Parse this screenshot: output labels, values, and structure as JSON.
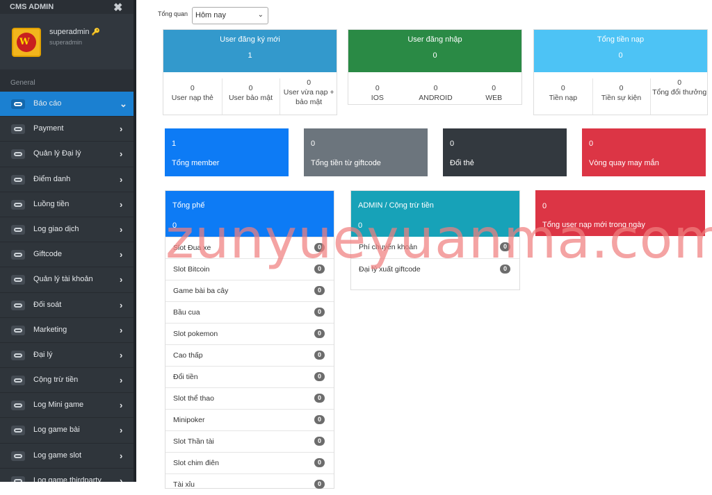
{
  "app_title": "CMS ADMIN",
  "profile": {
    "username": "superadmin",
    "role": "superadmin"
  },
  "section_label": "General",
  "menu": [
    {
      "label": "Báo cáo"
    },
    {
      "label": "Payment"
    },
    {
      "label": "Quản lý Đại lý"
    },
    {
      "label": "Điểm danh"
    },
    {
      "label": "Luồng tiền"
    },
    {
      "label": "Log giao dịch"
    },
    {
      "label": "Giftcode"
    },
    {
      "label": "Quản lý tài khoản"
    },
    {
      "label": "Đối soát"
    },
    {
      "label": "Marketing"
    },
    {
      "label": "Đại lý"
    },
    {
      "label": "Cộng trừ tiền"
    },
    {
      "label": "Log Mini game"
    },
    {
      "label": "Log game bài"
    },
    {
      "label": "Log game slot"
    },
    {
      "label": "Log game thirdparty"
    }
  ],
  "filter": {
    "label": "Tổng quan",
    "selected": "Hôm nay"
  },
  "cards": [
    {
      "title": "User đăng ký mới",
      "value": "1",
      "color": "#3399cc",
      "stats": [
        {
          "value": "0",
          "label": "User nạp thẻ"
        },
        {
          "value": "0",
          "label": "User bảo mật"
        },
        {
          "value": "0",
          "label": "User vừa nạp + bảo mật"
        }
      ]
    },
    {
      "title": "User đăng nhập",
      "value": "0",
      "color": "#2a8a45",
      "stats": [
        {
          "value": "0",
          "label": "IOS"
        },
        {
          "value": "0",
          "label": "ANDROID"
        },
        {
          "value": "0",
          "label": "WEB"
        }
      ]
    },
    {
      "title": "Tổng tiền nạp",
      "value": "0",
      "color": "#4dc3f5",
      "stats": [
        {
          "value": "0",
          "label": "Tiền nạp"
        },
        {
          "value": "0",
          "label": "Tiền sự kiện"
        },
        {
          "value": "0",
          "label": "Tổng đổi thưởng"
        }
      ]
    }
  ],
  "boxes": [
    {
      "value": "1",
      "label": "Tổng member",
      "color": "#0d7bf5"
    },
    {
      "value": "0",
      "label": "Tổng tiền từ giftcode",
      "color": "#6c757d"
    },
    {
      "value": "0",
      "label": "Đổi thẻ",
      "color": "#33393f"
    },
    {
      "value": "0",
      "label": "Vòng quay may mắn",
      "color": "#dc3545"
    }
  ],
  "panels": [
    {
      "title": "Tổng phế",
      "value": "0",
      "color": "#0d7bf5",
      "rows": [
        {
          "label": "Slot Đua xe",
          "badge": "0"
        },
        {
          "label": "Slot Bitcoin",
          "badge": "0"
        },
        {
          "label": "Game bài ba cây",
          "badge": "0"
        },
        {
          "label": "Bầu cua",
          "badge": "0"
        },
        {
          "label": "Slot pokemon",
          "badge": "0"
        },
        {
          "label": "Cao thấp",
          "badge": "0"
        },
        {
          "label": "Đổi tiền",
          "badge": "0"
        },
        {
          "label": "Slot thể thao",
          "badge": "0"
        },
        {
          "label": "Minipoker",
          "badge": "0"
        },
        {
          "label": "Slot Thần tài",
          "badge": "0"
        },
        {
          "label": "Slot chim điên",
          "badge": "0"
        },
        {
          "label": "Tài xỉu",
          "badge": "0"
        }
      ]
    },
    {
      "title": "ADMIN / Cộng trừ tiền",
      "value": "0",
      "color": "#17a2b8",
      "rows": [
        {
          "label": "Phí chuyển khoản",
          "badge": "0"
        },
        {
          "label": "Đại lý xuất giftcode",
          "badge": "0"
        }
      ]
    },
    {
      "title": "",
      "value": "0",
      "subtitle": "Tổng user nạp mới trong ngày",
      "color": "#dc3545",
      "rows": []
    }
  ],
  "watermark": "zunyueyuanma.com"
}
